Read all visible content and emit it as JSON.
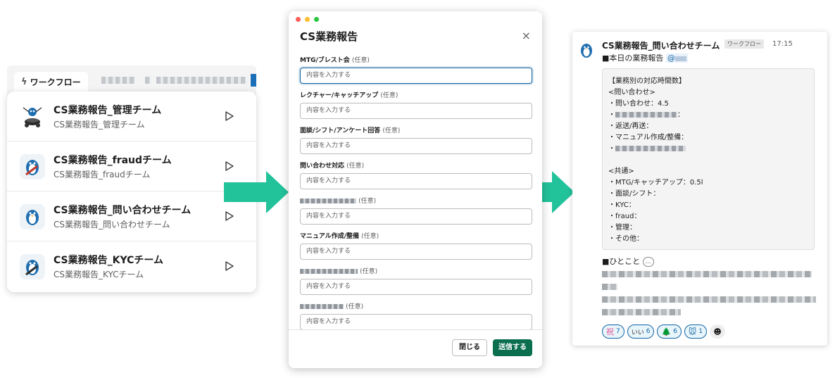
{
  "workflow_panel": {
    "tab_icon": "bolt-icon",
    "tab_label": "ワークフロー",
    "items": [
      {
        "title": "CS業務報告_管理チーム",
        "subtitle": "CS業務報告_管理チーム",
        "icon": "drummer-avatar-icon"
      },
      {
        "title": "CS業務報告_fraudチーム",
        "subtitle": "CS業務報告_fraudチーム",
        "icon": "guitar-penguin-avatar-icon"
      },
      {
        "title": "CS業務報告_問い合わせチーム",
        "subtitle": "CS業務報告_問い合わせチーム",
        "icon": "penguin-avatar-icon"
      },
      {
        "title": "CS業務報告_KYCチーム",
        "subtitle": "CS業務報告_KYCチーム",
        "icon": "guitar-penguin-avatar-icon"
      }
    ]
  },
  "modal": {
    "title": "CS業務報告",
    "close_icon": "×",
    "optional_label": "(任意)",
    "placeholder": "内容を入力する",
    "fields": [
      {
        "label": "MTG/ブレスト会"
      },
      {
        "label": "レクチャー/キャッチアップ"
      },
      {
        "label": "面談/シフト/アンケート回答"
      },
      {
        "label": "問い合わせ対応"
      },
      {
        "label": ""
      },
      {
        "label": "マニュアル作成/整備"
      },
      {
        "label": ""
      },
      {
        "label": ""
      }
    ],
    "close_button": "閉じる",
    "submit_button": "送信する"
  },
  "message": {
    "sender": "CS業務報告_問い合わせチーム",
    "badge": "ワークフロー",
    "time": "17:15",
    "heading": "■本日の業務報告",
    "mention_prefix": "@",
    "code_lines": [
      "【業務別の対応時間数】",
      "<問い合わせ>",
      "・問い合わせ：4.5",
      "・",
      "・返送/再送：",
      "・マニュアル作成/整備：",
      "・",
      "",
      "<共通>",
      "・MTG/キャッチアップ：0.5l",
      "・面談/シフト：",
      "・KYC：",
      "・fraud：",
      "・管理：",
      "・その他："
    ],
    "hitokoto": "■ひとこと",
    "reactions": [
      {
        "emoji": "祝",
        "count": "7"
      },
      {
        "emoji": "いい",
        "count": "6"
      },
      {
        "emoji": "🌲",
        "count": "6"
      },
      {
        "emoji": "🐭",
        "count": "1"
      }
    ]
  },
  "colors": {
    "accent_green": "#0a6e4f",
    "arrow_teal": "#22c29a",
    "focus_blue": "#1264a3"
  }
}
